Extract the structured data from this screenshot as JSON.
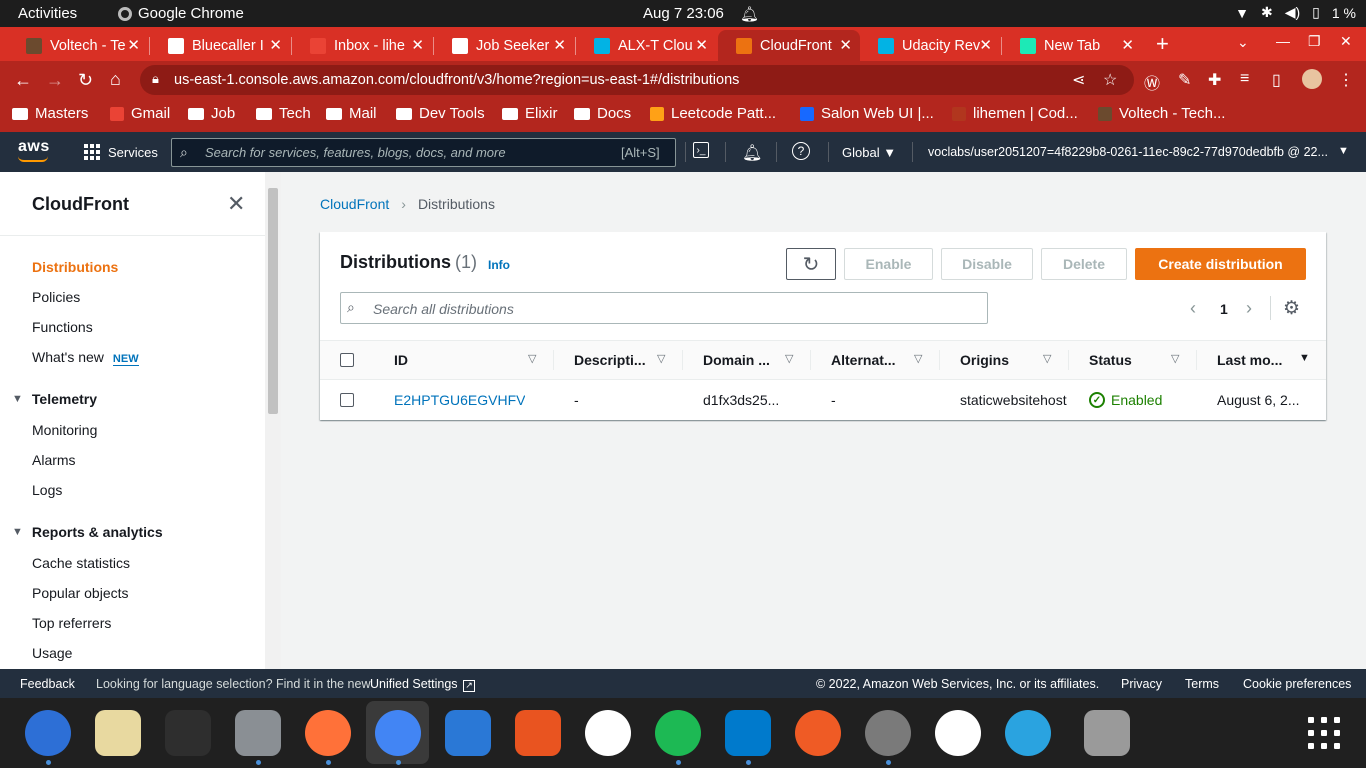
{
  "system_bar": {
    "activities": "Activities",
    "app_name": "Google Chrome",
    "clock": "Aug 7  23:06",
    "battery": "1 %"
  },
  "tabs": [
    {
      "label": "Voltech - Te",
      "favicon_color": "#6b4a2e"
    },
    {
      "label": "Bluecaller I",
      "favicon_color": "#ffffff"
    },
    {
      "label": "Inbox - lihe",
      "favicon_color": "#ea4335"
    },
    {
      "label": "Job Seeker",
      "favicon_color": "#ffffff"
    },
    {
      "label": "ALX-T Clou",
      "favicon_color": "#02b3e4"
    },
    {
      "label": "CloudFront",
      "favicon_color": "#ec7211",
      "active": true
    },
    {
      "label": "Udacity Rev",
      "favicon_color": "#02b3e4"
    },
    {
      "label": "New Tab",
      "favicon_color": "#1de9b6"
    }
  ],
  "address_bar": {
    "url": "us-east-1.console.aws.amazon.com/cloudfront/v3/home?region=us-east-1#/distributions"
  },
  "bookmarks": [
    {
      "label": "Masters",
      "icon": "folder-icon"
    },
    {
      "label": "Gmail",
      "icon": "gmail-icon"
    },
    {
      "label": "Job",
      "icon": "folder-icon"
    },
    {
      "label": "Tech",
      "icon": "folder-icon"
    },
    {
      "label": "Mail",
      "icon": "folder-icon"
    },
    {
      "label": "Dev Tools",
      "icon": "folder-icon"
    },
    {
      "label": "Elixir",
      "icon": "folder-icon"
    },
    {
      "label": "Docs",
      "icon": "folder-icon"
    },
    {
      "label": "Leetcode Patt...",
      "icon": "leetcode-icon"
    },
    {
      "label": "Salon Web UI |...",
      "icon": "behance-icon"
    },
    {
      "label": "lihemen | Cod...",
      "icon": "codewars-icon"
    },
    {
      "label": "Voltech - Tech...",
      "icon": "voltech-icon"
    }
  ],
  "aws_header": {
    "logo": "aws",
    "services": "Services",
    "search_placeholder": "Search for services, features, blogs, docs, and more",
    "search_shortcut": "[Alt+S]",
    "region": "Global ▼",
    "account": "voclabs/user2051207=4f8229b8-0261-11ec-89c2-77d970dedbfb @ 22..."
  },
  "sidebar": {
    "title": "CloudFront",
    "items": [
      {
        "label": "Distributions",
        "active": true
      },
      {
        "label": "Policies"
      },
      {
        "label": "Functions"
      },
      {
        "label": "What's new",
        "badge": "NEW"
      }
    ],
    "telemetry": {
      "title": "Telemetry",
      "items": [
        "Monitoring",
        "Alarms",
        "Logs"
      ]
    },
    "reports": {
      "title": "Reports & analytics",
      "items": [
        "Cache statistics",
        "Popular objects",
        "Top referrers",
        "Usage"
      ]
    }
  },
  "breadcrumb": {
    "root": "CloudFront",
    "current": "Distributions"
  },
  "distributions": {
    "title": "Distributions",
    "count": "(1)",
    "info": "Info",
    "buttons": {
      "enable": "Enable",
      "disable": "Disable",
      "delete": "Delete",
      "create": "Create distribution"
    },
    "search_placeholder": "Search all distributions",
    "page": "1",
    "columns": [
      "ID",
      "Descripti...",
      "Domain ...",
      "Alternat...",
      "Origins",
      "Status",
      "Last mo..."
    ],
    "rows": [
      {
        "id": "E2HPTGU6EGVHFV",
        "description": "-",
        "domain": "d1fx3ds25...",
        "alternate": "-",
        "origins": "staticwebsitehost",
        "status": "Enabled",
        "last_modified": "August 6, 2..."
      }
    ]
  },
  "footer": {
    "feedback": "Feedback",
    "language_prompt": "Looking for language selection? Find it in the new",
    "unified_settings": "Unified Settings",
    "copyright": "© 2022, Amazon Web Services, Inc. or its affiliates.",
    "privacy": "Privacy",
    "terms": "Terms",
    "cookies": "Cookie preferences"
  },
  "dock": [
    {
      "name": "thunderbird-icon",
      "color": "#2d6fd6"
    },
    {
      "name": "rhythmbox-icon",
      "color": "#e8d9a0"
    },
    {
      "name": "terminal-icon",
      "color": "#2e2e2e"
    },
    {
      "name": "files-icon",
      "color": "#8a8f94"
    },
    {
      "name": "firefox-icon",
      "color": "#ff7139"
    },
    {
      "name": "chrome-icon",
      "color": "#4285f4"
    },
    {
      "name": "writer-icon",
      "color": "#2a78d6"
    },
    {
      "name": "software-center-icon",
      "color": "#e95420"
    },
    {
      "name": "android-studio-icon",
      "color": "#ffffff"
    },
    {
      "name": "spotify-icon",
      "color": "#1db954"
    },
    {
      "name": "vscode-icon",
      "color": "#007acc"
    },
    {
      "name": "postman-icon",
      "color": "#ef5b25"
    },
    {
      "name": "settings-icon",
      "color": "#7a7a7a"
    },
    {
      "name": "slack-icon",
      "color": "#ffffff"
    },
    {
      "name": "telegram-icon",
      "color": "#2aa3e0"
    },
    {
      "name": "trash-icon",
      "color": "#9a9a9a"
    }
  ]
}
